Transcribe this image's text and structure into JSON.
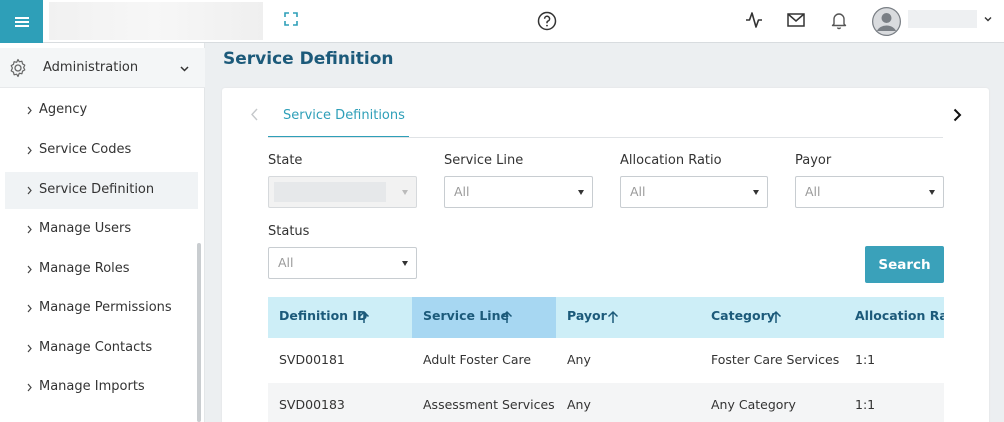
{
  "header": {
    "menu_icon": "hamburger-menu-icon",
    "expand_icon": "expand-icon",
    "help_icon": "help-circle-icon",
    "activity_icon": "activity-pulse-icon",
    "mail_icon": "mail-icon",
    "notifications_icon": "bell-icon",
    "avatar_icon": "user-avatar-icon",
    "brand_color": "#2e9fb8"
  },
  "sidebar": {
    "section": {
      "label": "Administration",
      "icon": "gear-icon",
      "expanded": true
    },
    "items": [
      {
        "label": "Agency",
        "active": false
      },
      {
        "label": "Service Codes",
        "active": false
      },
      {
        "label": "Service Definition",
        "active": true
      },
      {
        "label": "Manage Users",
        "active": false
      },
      {
        "label": "Manage Roles",
        "active": false
      },
      {
        "label": "Manage Permissions",
        "active": false
      },
      {
        "label": "Manage Contacts",
        "active": false
      },
      {
        "label": "Manage Imports",
        "active": false
      }
    ]
  },
  "main": {
    "page_title": "Service Definition",
    "tabs": [
      {
        "label": "Service Definitions",
        "active": true
      }
    ],
    "filters": {
      "state": {
        "label": "State",
        "value": "",
        "disabled": true
      },
      "service_line": {
        "label": "Service Line",
        "value": "All"
      },
      "allocation_ratio": {
        "label": "Allocation Ratio",
        "value": "All"
      },
      "payor": {
        "label": "Payor",
        "value": "All"
      },
      "status": {
        "label": "Status",
        "value": "All"
      }
    },
    "search_label": "Search",
    "table": {
      "columns": [
        "Definition ID",
        "Service Line",
        "Payor",
        "Category",
        "Allocation Ratio"
      ],
      "sorted_column": "Service Line",
      "rows": [
        [
          "SVD00181",
          "Adult Foster Care",
          "Any",
          "Foster Care Services",
          "1:1"
        ],
        [
          "SVD00183",
          "Assessment Services",
          "Any",
          "Any Category",
          "1:1"
        ]
      ]
    }
  }
}
